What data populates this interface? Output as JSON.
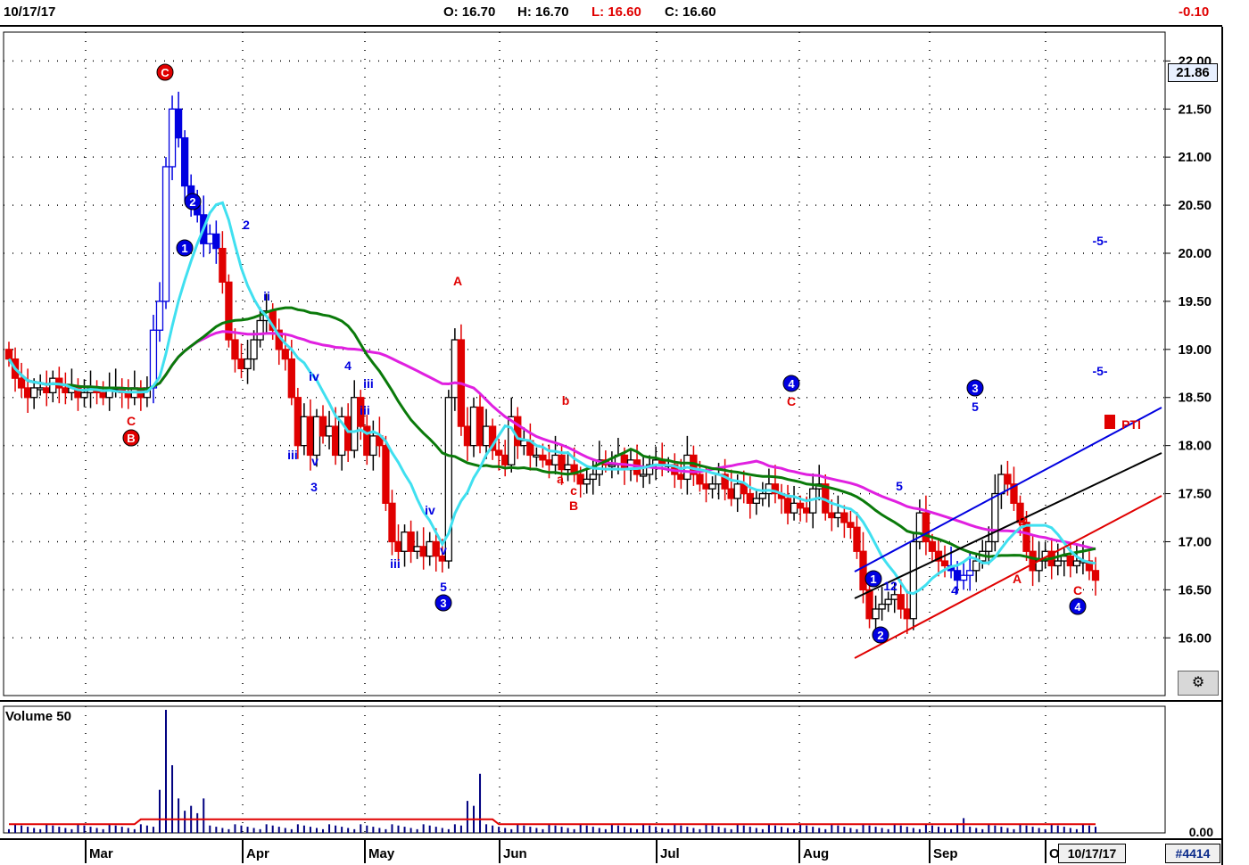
{
  "header": {
    "date": "10/17/17",
    "open_label": "O: 16.70",
    "high_label": "H: 16.70",
    "low_label": "L: 16.60",
    "close_label": "C: 16.60",
    "change": "-0.10"
  },
  "price_tag": "21.86",
  "footer": {
    "date_box": "10/17/17",
    "symbol": "#4414"
  },
  "volume_panel": {
    "title": "Volume 50",
    "axis_label": "0.00"
  },
  "colors": {
    "up": "#000000",
    "down": "#e00000",
    "impulse": "#0000e0",
    "cyan": "#40e0f0",
    "green": "#0a7a0a",
    "magenta": "#e020e0",
    "volume": "#000080",
    "volume_ma": "#e00000"
  },
  "chart_data": {
    "type": "candlestick",
    "y_ticks": [
      "22.00",
      "21.50",
      "21.00",
      "20.50",
      "20.00",
      "19.50",
      "19.00",
      "18.50",
      "18.00",
      "17.50",
      "17.00",
      "16.50",
      "16.00"
    ],
    "ylim": [
      15.4,
      22.3
    ],
    "x_ticks": [
      "Mar",
      "Apr",
      "May",
      "Jun",
      "Jul",
      "Aug",
      "Sep",
      "O"
    ],
    "grid": true,
    "series_close": [
      18.9,
      18.7,
      18.6,
      18.5,
      18.6,
      18.6,
      18.55,
      18.7,
      18.6,
      18.55,
      18.6,
      18.5,
      18.55,
      18.6,
      18.55,
      18.5,
      18.6,
      18.6,
      18.55,
      18.5,
      18.6,
      18.5,
      18.6,
      19.2,
      19.5,
      20.9,
      21.5,
      21.2,
      20.7,
      20.5,
      20.4,
      20.1,
      20.2,
      20.05,
      19.7,
      19.1,
      18.9,
      18.8,
      18.9,
      19.1,
      19.3,
      19.4,
      19.2,
      19.0,
      18.9,
      18.5,
      18.0,
      18.3,
      17.9,
      18.3,
      18.1,
      18.2,
      17.9,
      18.3,
      17.95,
      18.5,
      18.2,
      17.9,
      18.1,
      18.0,
      17.4,
      17.0,
      16.9,
      17.1,
      16.9,
      16.95,
      16.85,
      17.0,
      16.85,
      16.8,
      18.5,
      19.1,
      18.2,
      18.0,
      18.4,
      18.0,
      18.2,
      17.95,
      17.9,
      17.8,
      18.3,
      18.0,
      18.05,
      17.9,
      17.9,
      17.85,
      17.8,
      17.9,
      17.75,
      17.8,
      17.7,
      17.6,
      17.65,
      17.7,
      17.85,
      17.8,
      17.8,
      17.9,
      17.75,
      17.85,
      17.7,
      17.7,
      17.8,
      17.85,
      17.8,
      17.8,
      17.7,
      17.65,
      17.9,
      17.7,
      17.6,
      17.55,
      17.6,
      17.7,
      17.55,
      17.45,
      17.6,
      17.5,
      17.4,
      17.45,
      17.5,
      17.6,
      17.5,
      17.45,
      17.3,
      17.4,
      17.35,
      17.3,
      17.55,
      17.6,
      17.3,
      17.25,
      17.3,
      17.2,
      17.15,
      16.9,
      16.5,
      16.2,
      16.3,
      16.35,
      16.4,
      16.45,
      16.3,
      16.2,
      17.0,
      17.3,
      17.0,
      16.9,
      16.8,
      16.75,
      16.7,
      16.6,
      16.65,
      16.7,
      16.8,
      16.9,
      17.0,
      17.5,
      17.7,
      17.6,
      17.4,
      17.2,
      16.9,
      16.7,
      16.8,
      16.9,
      16.75,
      16.8,
      16.85,
      16.75,
      16.8,
      16.8,
      16.7,
      16.6
    ],
    "moving_averages": [
      {
        "name": "cyan",
        "color": "cyan"
      },
      {
        "name": "green",
        "color": "green"
      },
      {
        "name": "magenta",
        "color": "magenta"
      }
    ],
    "wave_labels": [
      "C",
      "B",
      "C",
      "1",
      "2",
      "2",
      "ii",
      "iii",
      "iv",
      "v",
      "iii",
      "3",
      "4",
      "iii",
      "A",
      "iv",
      "iii",
      "v",
      "5",
      "3",
      "b",
      "a",
      "c",
      "B",
      "4",
      "C",
      "1",
      "2",
      "12",
      "5",
      "4",
      "3",
      "5",
      "B",
      "A",
      "C",
      "4",
      "-5-",
      "-5-",
      "3",
      "PTI"
    ],
    "volume": {
      "ylim": [
        0,
        1
      ],
      "spikes": [
        0.35,
        1.0,
        0.55,
        0.28,
        0.18,
        0.22,
        0.16,
        0.28,
        0.26,
        0.22,
        0.48,
        0.12
      ]
    }
  }
}
